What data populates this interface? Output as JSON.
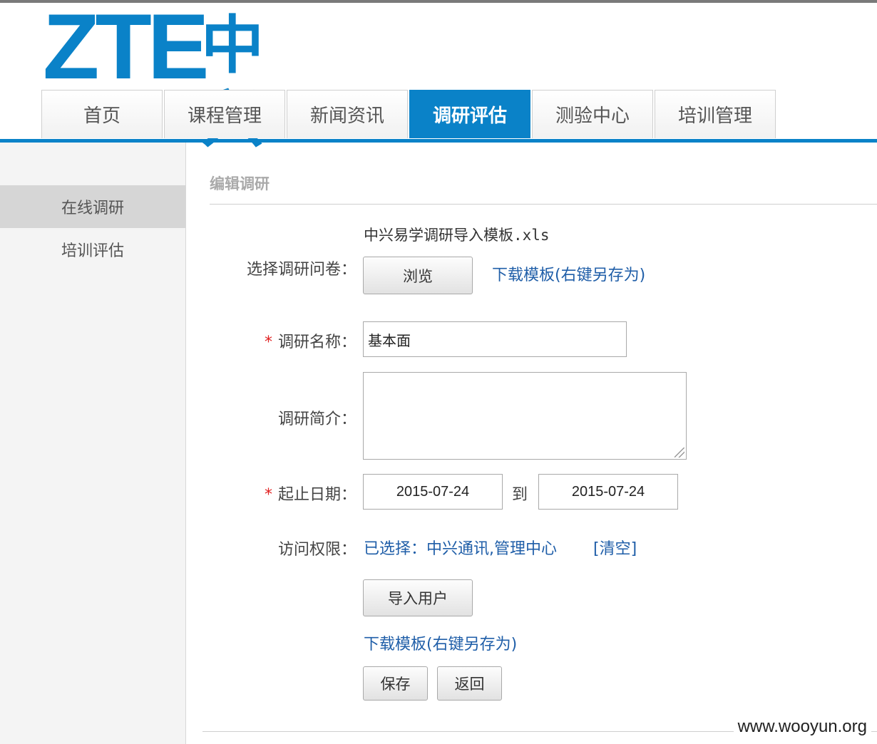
{
  "logo": {
    "latin": "ZTE",
    "cn": "中兴"
  },
  "nav": {
    "tabs": [
      {
        "label": "首页"
      },
      {
        "label": "课程管理"
      },
      {
        "label": "新闻资讯"
      },
      {
        "label": "调研评估"
      },
      {
        "label": "测验中心"
      },
      {
        "label": "培训管理"
      }
    ],
    "active_index": 3
  },
  "sidebar": {
    "items": [
      {
        "label": "在线调研",
        "active": true
      },
      {
        "label": "培训评估",
        "active": false
      }
    ]
  },
  "form": {
    "title": "编辑调研",
    "file": {
      "label": "选择调研问卷",
      "filename": "中兴易学调研导入模板.xls",
      "browse_label": "浏览",
      "template_link": "下载模板(右键另存为)"
    },
    "name": {
      "required_mark": "*",
      "label": "调研名称",
      "value": "基本面"
    },
    "intro": {
      "label": "调研简介",
      "value": ""
    },
    "dates": {
      "required_mark": "*",
      "label": "起止日期",
      "start": "2015-07-24",
      "separator": "到",
      "end": "2015-07-24"
    },
    "access": {
      "label": "访问权限",
      "selected": "已选择：中兴通讯,管理中心",
      "clear_label": "[清空]"
    },
    "import_users_label": "导入用户",
    "user_template_link": "下载模板(右键另存为)",
    "save_label": "保存",
    "back_label": "返回",
    "colon": "："
  },
  "watermark": "www.wooyun.org",
  "colors": {
    "brand_blue": "#0a82c8",
    "link_blue": "#1f5ea8",
    "required_red": "#e02020"
  }
}
